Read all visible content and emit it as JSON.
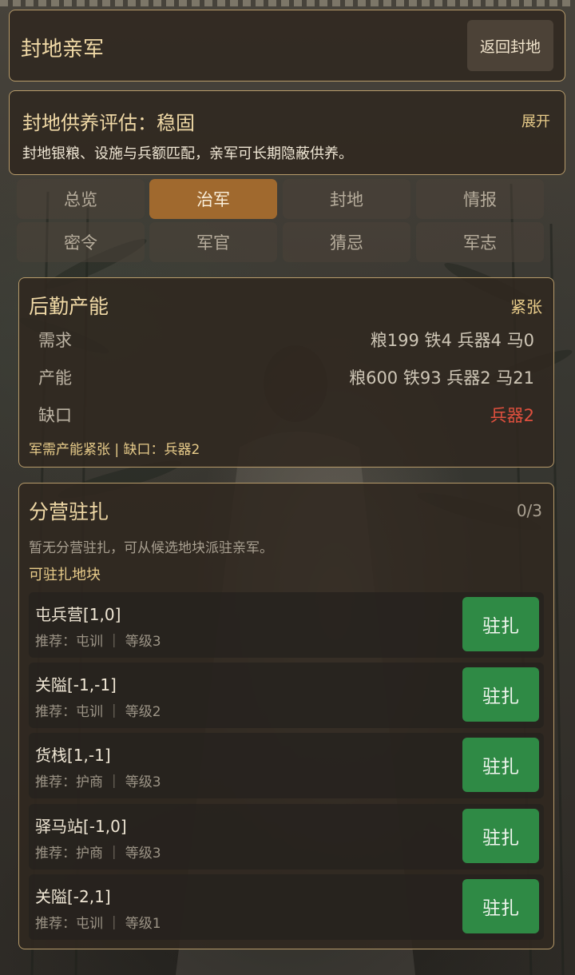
{
  "header": {
    "title": "封地亲军",
    "back_label": "返回封地"
  },
  "assessment": {
    "title": "封地供养评估：稳固",
    "expand_label": "展开",
    "description": "封地银粮、设施与兵额匹配，亲军可长期隐蔽供养。"
  },
  "tabs": [
    {
      "label": "总览",
      "active": false
    },
    {
      "label": "治军",
      "active": true
    },
    {
      "label": "封地",
      "active": false
    },
    {
      "label": "情报",
      "active": false
    },
    {
      "label": "密令",
      "active": false
    },
    {
      "label": "军官",
      "active": false
    },
    {
      "label": "猜忌",
      "active": false
    },
    {
      "label": "军志",
      "active": false
    }
  ],
  "logistics": {
    "title": "后勤产能",
    "status": "紧张",
    "rows": [
      {
        "label": "需求",
        "value": "粮199 铁4 兵器4 马0"
      },
      {
        "label": "产能",
        "value": "粮600 铁93 兵器2 马21"
      },
      {
        "label": "缺口",
        "value": "兵器2"
      }
    ],
    "note": "军需产能紧张 | 缺口：兵器2",
    "colors": {
      "shortage": "#e0503e"
    }
  },
  "garrison": {
    "title": "分营驻扎",
    "count": "0/3",
    "empty_text": "暂无分营驻扎，可从候选地块派驻亲军。",
    "subtitle": "可驻扎地块",
    "plots": [
      {
        "name": "屯兵营[1,0]",
        "meta": "推荐：屯训 ｜ 等级3",
        "button": "驻扎"
      },
      {
        "name": "关隘[-1,-1]",
        "meta": "推荐：屯训 ｜ 等级2",
        "button": "驻扎"
      },
      {
        "name": "货栈[1,-1]",
        "meta": "推荐：护商 ｜ 等级3",
        "button": "驻扎"
      },
      {
        "name": "驿马站[-1,0]",
        "meta": "推荐：护商 ｜ 等级3",
        "button": "驻扎"
      },
      {
        "name": "关隘[-2,1]",
        "meta": "推荐：屯训 ｜ 等级1",
        "button": "驻扎"
      }
    ]
  },
  "colors": {
    "accent_gold": "#e8cc8a",
    "tab_active": "#a0692e",
    "action_green": "#2f8a45"
  }
}
